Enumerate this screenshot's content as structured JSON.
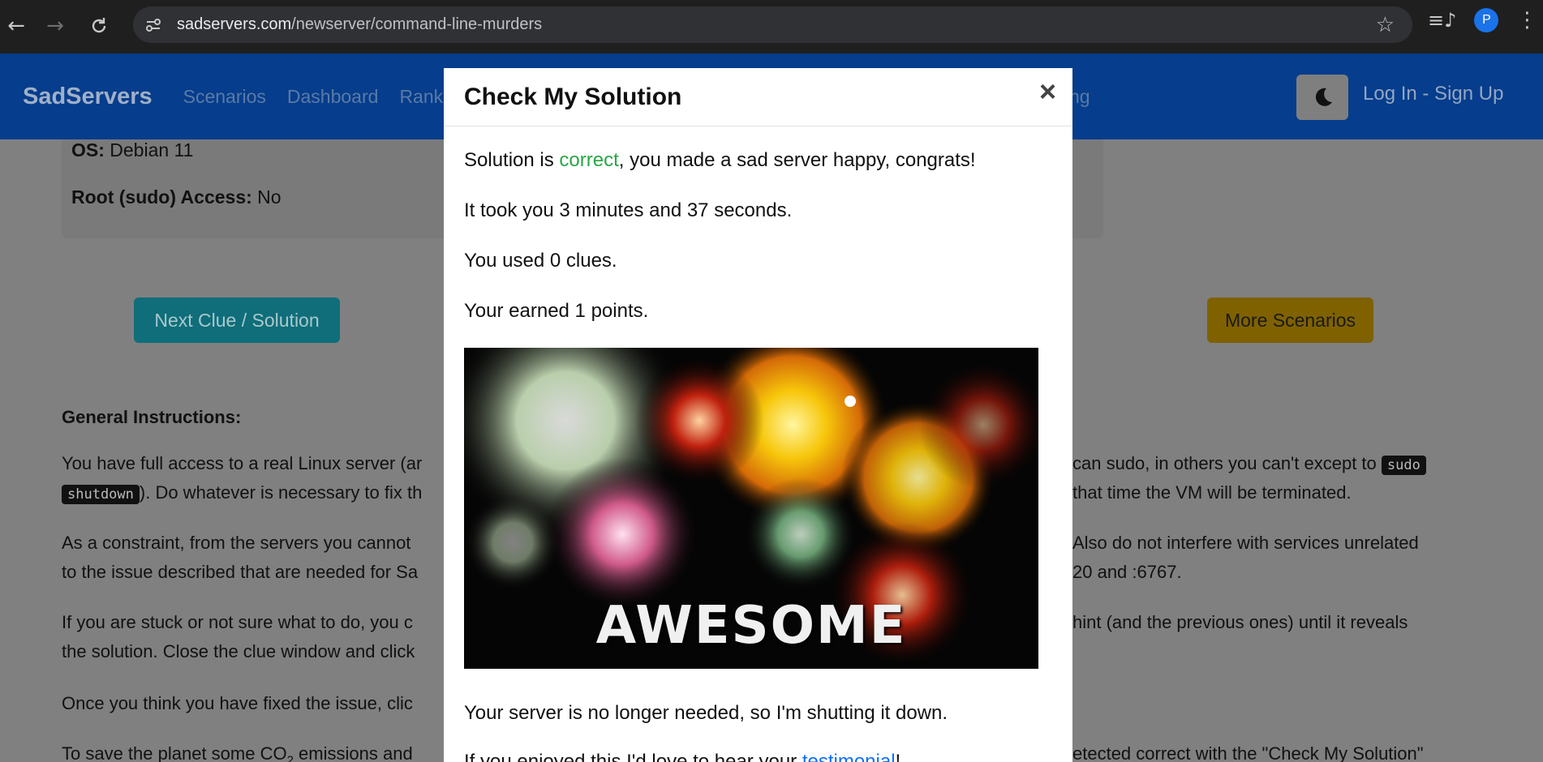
{
  "browser": {
    "url_host": "sadservers.com",
    "url_path": "/newserver/command-line-murders",
    "profile_initial": "P"
  },
  "navbar": {
    "brand": "SadServers",
    "links": [
      "Scenarios",
      "Dashboard",
      "Ranki"
    ],
    "hidden_link_fragment": "ng",
    "login": "Log In - Sign Up"
  },
  "info": {
    "os_label": "OS:",
    "os_value": "Debian 11",
    "root_label": "Root (sudo) Access:",
    "root_value": "No"
  },
  "buttons": {
    "next_clue": "Next Clue / Solution",
    "more_scenarios": "More Scenarios"
  },
  "instructions": {
    "title": "General Instructions:",
    "p1_left": "You have full access to a real Linux server (ar",
    "p1_right": "can sudo, in others you can't except to",
    "p1_code1": "sudo",
    "p1_code2": "shutdown",
    "p1_line2_left": "). Do whatever is necessary to fix th",
    "p1_line2_right": "that time the VM will be terminated.",
    "p2_left1": "As a constraint, from the servers you cannot",
    "p2_right1": "Also do not interfere with services unrelated",
    "p2_left2": "to the issue described that are needed for Sa",
    "p2_right2": "20 and :6767.",
    "p3_left1": "If you are stuck or not sure what to do, you c",
    "p3_right1": "hint (and the previous ones) until it reveals",
    "p3_left2": "the solution. Close the clue window and click",
    "p4_left": "Once you think you have fixed the issue, clic",
    "p5_left": "To save the planet some CO",
    "p5_sub": "2",
    "p5_left_end": " emissions and",
    "p5_right": "etected correct with the \"Check My Solution\""
  },
  "modal": {
    "title": "Check My Solution",
    "close": "×",
    "line1_a": "Solution is ",
    "line1_correct": "correct",
    "line1_b": ", you made a sad server happy, congrats!",
    "line2": "It took you 3 minutes and 37 seconds.",
    "line3": "You used 0 clues.",
    "line4": "Your earned 1 points.",
    "image_text": "AWESOME",
    "line5": "Your server is no longer needed, so I'm shutting it down.",
    "line6_a": "If you enjoyed this I'd love to hear your ",
    "line6_link": "testimonial",
    "line6_b": "!"
  },
  "colors": {
    "navbar": "#0d6efd",
    "next_button": "#17a2b8",
    "more_button": "#ffc107",
    "correct": "#28a745"
  },
  "icons": [
    "back-arrow-icon",
    "forward-arrow-icon",
    "reload-icon",
    "site-info-icon",
    "star-icon",
    "media-icon",
    "kebab-icon",
    "moon-icon",
    "close-icon"
  ]
}
